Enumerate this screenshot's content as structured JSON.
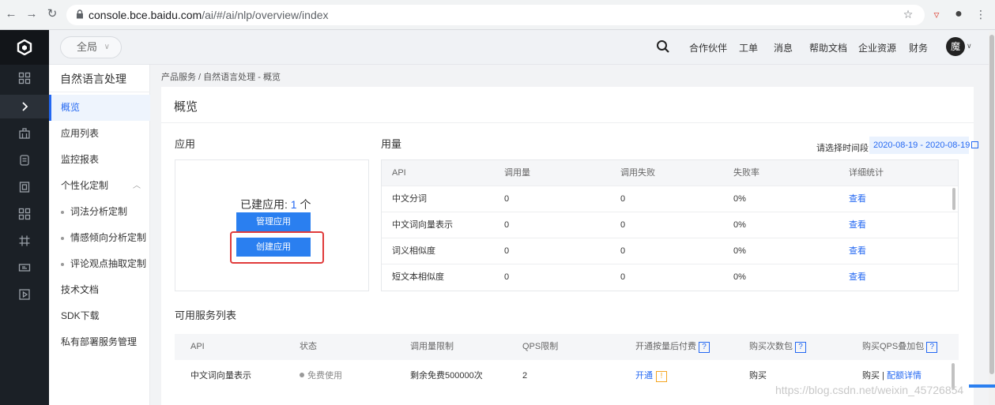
{
  "browser": {
    "url_domain": "console.bce.baidu.com",
    "url_path": "/ai/#/ai/nlp/overview/index"
  },
  "topbar": {
    "region": "全局",
    "links": [
      "合作伙伴",
      "工单",
      "消息",
      "帮助文档",
      "企业资源",
      "财务"
    ],
    "avatar_text": "魔"
  },
  "product_sidebar": {
    "title": "自然语言处理",
    "items": [
      {
        "label": "概览",
        "active": true
      },
      {
        "label": "应用列表"
      },
      {
        "label": "监控报表"
      },
      {
        "label": "个性化定制",
        "expandable": true
      },
      {
        "label": "词法分析定制",
        "sub": true
      },
      {
        "label": "情感倾向分析定制",
        "sub": true
      },
      {
        "label": "评论观点抽取定制",
        "sub": true
      },
      {
        "label": "技术文档"
      },
      {
        "label": "SDK下载"
      },
      {
        "label": "私有部署服务管理"
      }
    ]
  },
  "breadcrumb": "产品服务 / 自然语言处理 - 概览",
  "page_title": "概览",
  "apps": {
    "section_title": "应用",
    "count_label": "已建应用: ",
    "count_value": "1",
    "count_unit": " 个",
    "manage_button": "管理应用",
    "create_button": "创建应用"
  },
  "usage": {
    "section_title": "用量",
    "date_label": "请选择时间段",
    "date_range": "2020-08-19 - 2020-08-19",
    "columns": [
      "API",
      "调用量",
      "调用失败",
      "失败率",
      "详细统计"
    ],
    "rows": [
      [
        "中文分词",
        "0",
        "0",
        "0%",
        "查看"
      ],
      [
        "中文词向量表示",
        "0",
        "0",
        "0%",
        "查看"
      ],
      [
        "词义相似度",
        "0",
        "0",
        "0%",
        "查看"
      ],
      [
        "短文本相似度",
        "0",
        "0",
        "0%",
        "查看"
      ]
    ]
  },
  "services": {
    "section_title": "可用服务列表",
    "columns": [
      "API",
      "状态",
      "调用量限制",
      "QPS限制",
      "开通按量后付费",
      "购买次数包",
      "购买QPS叠加包"
    ],
    "help_mark": "?",
    "rows": [
      {
        "api": "中文词向量表示",
        "status": "免费使用",
        "call_limit": "剩余免费500000次",
        "qps": "2",
        "postpaid": "开通",
        "warn_mark": "!",
        "buy_pack": "购买",
        "qps_pack": "购买",
        "qps_pack_sep": " | ",
        "qps_pack_detail": "配额详情"
      }
    ]
  },
  "watermark": "https://blog.csdn.net/weixin_45726854",
  "colors": {
    "accent": "#2468f2",
    "rail_bg": "#1b2026",
    "highlight_border": "#e03b3b"
  }
}
